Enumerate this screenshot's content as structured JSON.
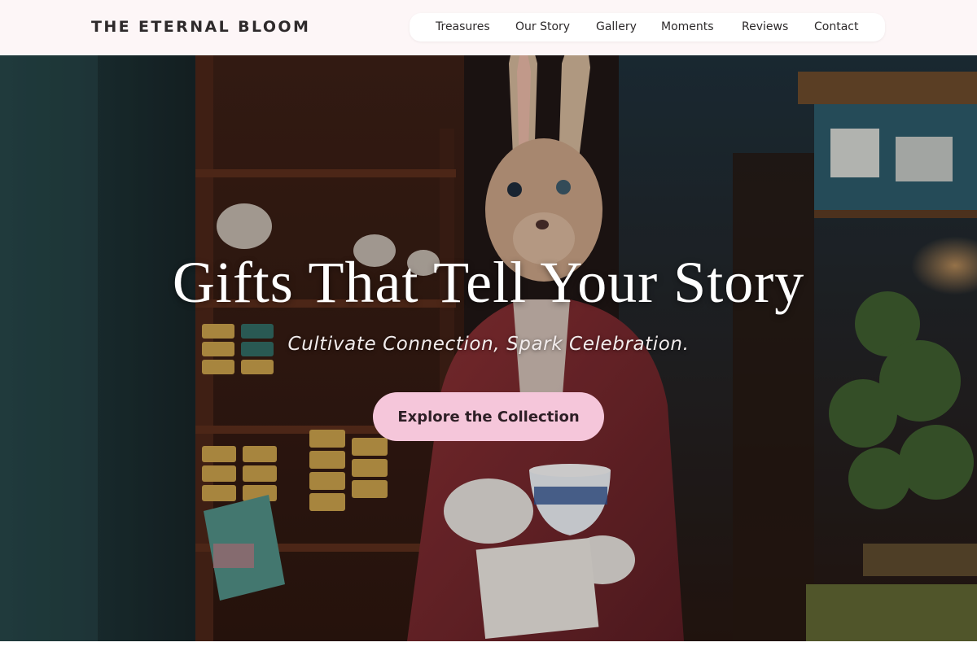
{
  "brand": {
    "name": "THE ETERNAL BLOOM"
  },
  "nav": {
    "items": [
      {
        "label": "Treasures"
      },
      {
        "label": "Our Story"
      },
      {
        "label": "Gallery"
      },
      {
        "label": "Moments"
      },
      {
        "label": "Reviews"
      },
      {
        "label": "Contact"
      }
    ]
  },
  "hero": {
    "title": "Gifts That Tell Your Story",
    "subtitle": "Cultivate Connection, Spark Celebration.",
    "cta_label": "Explore the Collection"
  },
  "colors": {
    "header_bg": "#fdf6f7",
    "cta_bg": "#f5c6da",
    "cta_text": "#2e1f26"
  }
}
